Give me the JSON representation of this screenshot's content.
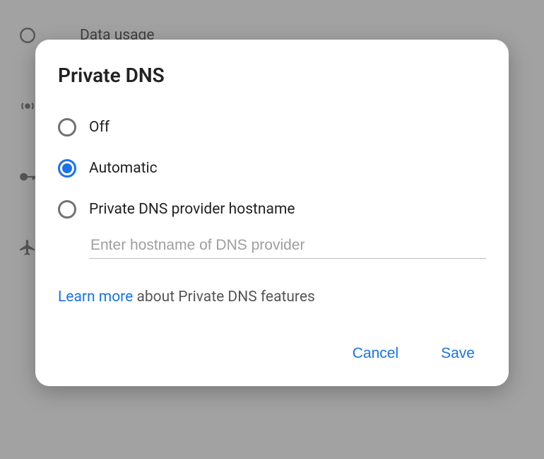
{
  "background": {
    "rows": [
      {
        "icon": "data-usage-icon",
        "label": "Data usage"
      },
      {
        "icon": "hotspot-icon",
        "label": ""
      },
      {
        "icon": "vpn-icon",
        "label": ""
      },
      {
        "icon": "airplane-icon",
        "label": ""
      }
    ]
  },
  "dialog": {
    "title": "Private DNS",
    "options": {
      "off": {
        "label": "Off",
        "selected": false
      },
      "auto": {
        "label": "Automatic",
        "selected": true
      },
      "hostname": {
        "label": "Private DNS provider hostname",
        "selected": false
      }
    },
    "hostname_input": {
      "value": "",
      "placeholder": "Enter hostname of DNS provider"
    },
    "info": {
      "link_text": "Learn more",
      "tail_text": " about Private DNS features"
    },
    "actions": {
      "cancel": "Cancel",
      "save": "Save"
    }
  },
  "colors": {
    "accent": "#1a73e8"
  }
}
